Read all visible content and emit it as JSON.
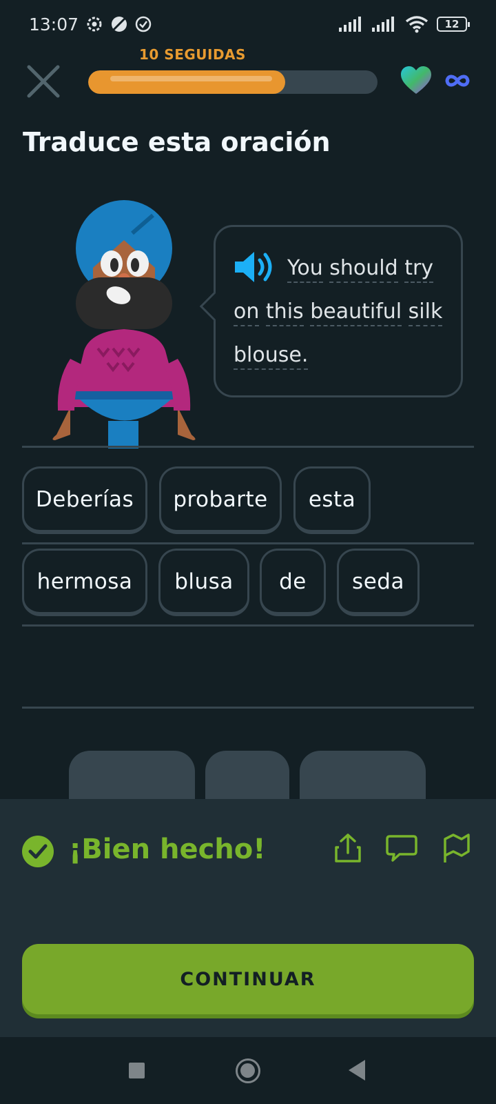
{
  "status_bar": {
    "time": "13:07",
    "battery": "12"
  },
  "header": {
    "streak_label": "10 SEGUIDAS",
    "progress": 0.68,
    "hearts": "infinite"
  },
  "exercise": {
    "title": "Traduce esta oración",
    "prompt_words": [
      "You",
      "should",
      "try",
      "on",
      "this",
      "beautiful",
      "silk",
      "blouse."
    ]
  },
  "answer_rows": [
    [
      "Deberías",
      "probarte",
      "esta"
    ],
    [
      "hermosa",
      "blusa",
      "de",
      "seda"
    ]
  ],
  "feedback": {
    "title": "¡Bien hecho!",
    "continue_label": "CONTINUAR"
  },
  "colors": {
    "background": "#131f24",
    "accent_green": "#79b52c",
    "streak_orange": "#e89b30",
    "border": "#37464f"
  }
}
